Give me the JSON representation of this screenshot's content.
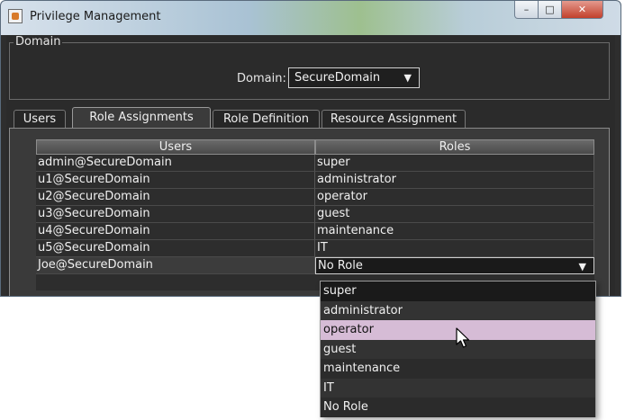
{
  "window": {
    "title": "Privilege Management"
  },
  "domain": {
    "group_title": "Domain",
    "label": "Domain:",
    "selected": "SecureDomain"
  },
  "tabs": [
    {
      "label": "Users",
      "active": false
    },
    {
      "label": "Role Assignments",
      "active": true
    },
    {
      "label": "Role Definition",
      "active": false
    },
    {
      "label": "Resource Assignment",
      "active": false
    }
  ],
  "table": {
    "headers": [
      "Users",
      "Roles"
    ],
    "rows": [
      {
        "user": "admin@SecureDomain",
        "role": "super"
      },
      {
        "user": "u1@SecureDomain",
        "role": "administrator"
      },
      {
        "user": "u2@SecureDomain",
        "role": "operator"
      },
      {
        "user": "u3@SecureDomain",
        "role": "guest"
      },
      {
        "user": "u4@SecureDomain",
        "role": "maintenance"
      },
      {
        "user": "u5@SecureDomain",
        "role": "IT"
      },
      {
        "user": "Joe@SecureDomain",
        "role": "No Role"
      }
    ]
  },
  "role_dropdown": {
    "options": [
      "super",
      "administrator",
      "operator",
      "guest",
      "maintenance",
      "IT",
      "No Role"
    ],
    "highlighted": "operator"
  },
  "colors": {
    "hover": "#d6bcd6",
    "panel": "#3a3a3a",
    "background": "#2b2b2b"
  }
}
